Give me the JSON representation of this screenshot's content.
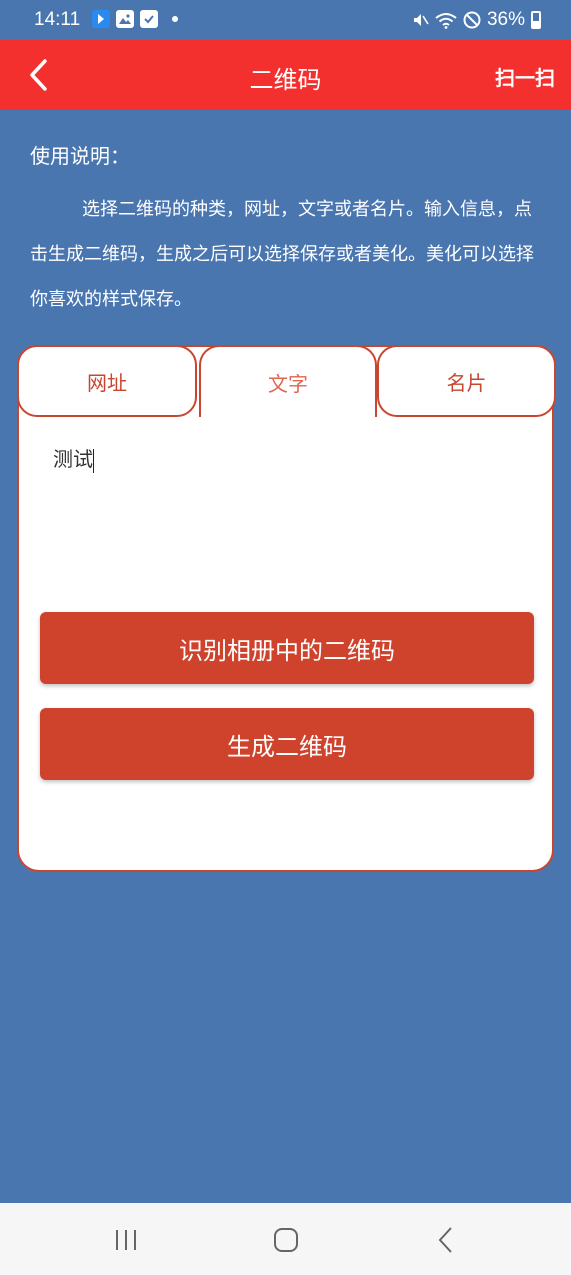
{
  "status_bar": {
    "time": "14:11",
    "battery": "36%",
    "icons": [
      "notification-app-icon",
      "image-icon",
      "checkbox-icon",
      "dot-icon",
      "mute-icon",
      "wifi-icon",
      "no-disturb-icon",
      "battery-icon"
    ]
  },
  "app_bar": {
    "title": "二维码",
    "scan_label": "扫一扫",
    "back_icon": "chevron-left-icon"
  },
  "instructions": {
    "title": "使用说明：",
    "body": "选择二维码的种类，网址，文字或者名片。输入信息，点击生成二维码，生成之后可以选择保存或者美化。美化可以选择你喜欢的样式保存。"
  },
  "tabs": [
    {
      "label": "网址",
      "selected": false
    },
    {
      "label": "文字",
      "selected": true
    },
    {
      "label": "名片",
      "selected": false
    }
  ],
  "input": {
    "value": "测试"
  },
  "buttons": {
    "recognize": "识别相册中的二维码",
    "generate": "生成二维码"
  },
  "nav_bar": {
    "icons": [
      "recent-apps-icon",
      "home-icon",
      "back-icon"
    ]
  },
  "colors": {
    "background": "#4a76b0",
    "app_bar": "#f4302f",
    "accent": "#cf432d"
  }
}
